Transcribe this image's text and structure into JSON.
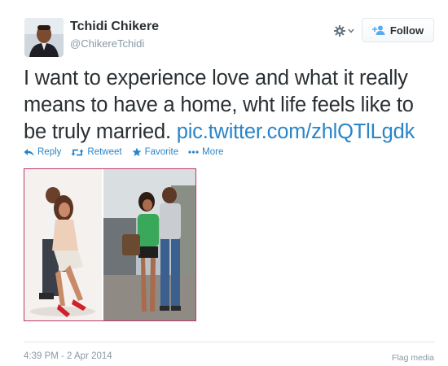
{
  "user": {
    "name": "Tchidi Chikere",
    "screen_name": "@ChikereTchidi"
  },
  "header": {
    "follow_label": "Follow",
    "follow_icon": "add-user-icon",
    "settings_icon": "gear-icon"
  },
  "tweet": {
    "text": "I want to experience love and what it really means to have a home, wht life feels like to be truly married.",
    "link": "pic.twitter.com/zhlQTlLgdk"
  },
  "actions": {
    "reply": "Reply",
    "retweet": "Retweet",
    "favorite": "Favorite",
    "more": "More"
  },
  "footer": {
    "timestamp": "4:39 PM - 2 Apr 2014",
    "flag": "Flag media"
  },
  "colors": {
    "link": "#2a85c8",
    "text": "#292f33",
    "muted": "#8899a6",
    "photo_border": "#c0386d",
    "follow_plus": "#55acee"
  }
}
